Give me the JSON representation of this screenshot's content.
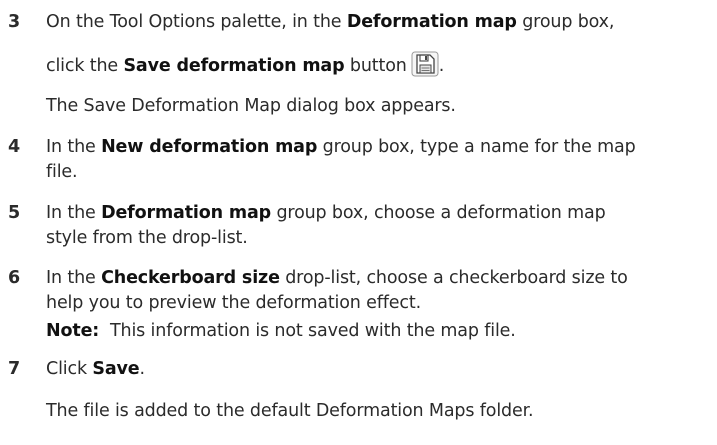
{
  "steps": [
    {
      "number": "3",
      "line1": {
        "pre": "On the Tool Options palette, in the ",
        "bold": "Deformation map",
        "post": " group box,"
      },
      "line2": {
        "pre": "click the ",
        "bold": "Save deformation map",
        "post": " button",
        "tail": "."
      },
      "icon": "save-icon",
      "result": "The Save Deformation Map dialog box appears."
    },
    {
      "number": "4",
      "line1": {
        "pre": "In the ",
        "bold": "New deformation map",
        "post": " group box, type a name for the map"
      },
      "line2": "file."
    },
    {
      "number": "5",
      "line1": {
        "pre": "In the ",
        "bold": "Deformation map",
        "post": " group box, choose a deformation map"
      },
      "line2": "style from the drop-list."
    },
    {
      "number": "6",
      "line1": {
        "pre": "In the ",
        "bold": "Checkerboard size",
        "post": " drop-list, choose a checkerboard size to"
      },
      "line2": "help you to preview the deformation effect.",
      "note_label": "Note:",
      "note_text": "  This information is not saved with the map file."
    },
    {
      "number": "7",
      "line1": {
        "pre": "Click ",
        "bold": "Save",
        "post": "."
      },
      "result": "The file is added to the default Deformation Maps folder."
    }
  ]
}
